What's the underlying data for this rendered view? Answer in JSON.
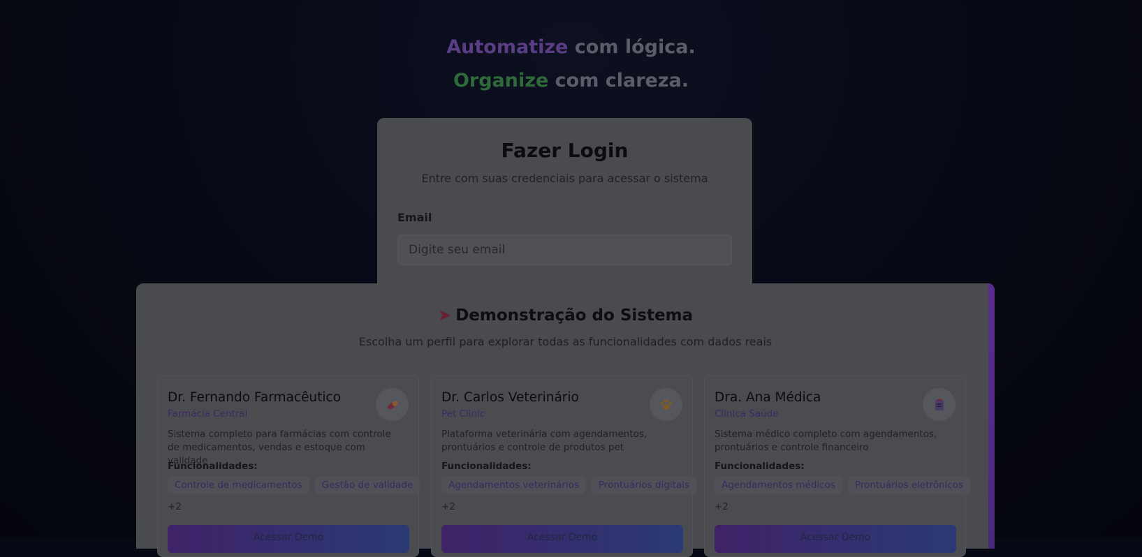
{
  "hero": {
    "line1_highlight": "Automatize",
    "line1_rest": " com lógica.",
    "line2_highlight": "Organize",
    "line2_rest": " com clareza."
  },
  "login": {
    "title": "Fazer Login",
    "subtitle": "Entre com suas credenciais para acessar o sistema",
    "email_label": "Email",
    "email_placeholder": "Digite seu email",
    "email_value": ""
  },
  "demo": {
    "title": "Demonstração do Sistema",
    "title_icon": "rocket-icon",
    "subtitle": "Escolha um perfil para explorar todas as funcionalidades com dados reais",
    "features_label": "Funcionalidades:",
    "button_label": "Acessar Demo",
    "profiles": [
      {
        "name": "Dr. Fernando Farmacêutico",
        "company": "Farmácia Central",
        "icon": "pill-icon",
        "description": "Sistema completo para farmácias com controle de medicamentos, vendas e estoque com validade",
        "features": [
          "Controle de medicamentos",
          "Gestão de validade"
        ],
        "more": "+2"
      },
      {
        "name": "Dr. Carlos Veterinário",
        "company": "Pet Clinic",
        "icon": "paw-icon",
        "description": "Plataforma veterinária com agendamentos, prontuários e controle de produtos pet",
        "features": [
          "Agendamentos veterinários",
          "Prontuários digitais"
        ],
        "more": "+2"
      },
      {
        "name": "Dra. Ana Médica",
        "company": "Clínica Saúde",
        "icon": "clipboard-icon",
        "description": "Sistema médico completo com agendamentos, prontuários e controle financeiro",
        "features": [
          "Agendamentos médicos",
          "Prontuários eletrônicos"
        ],
        "more": "+2"
      }
    ]
  },
  "colors": {
    "accent_purple": "#7a3fc8",
    "accent_green": "#3f9d4f",
    "overlay": "#000000"
  }
}
